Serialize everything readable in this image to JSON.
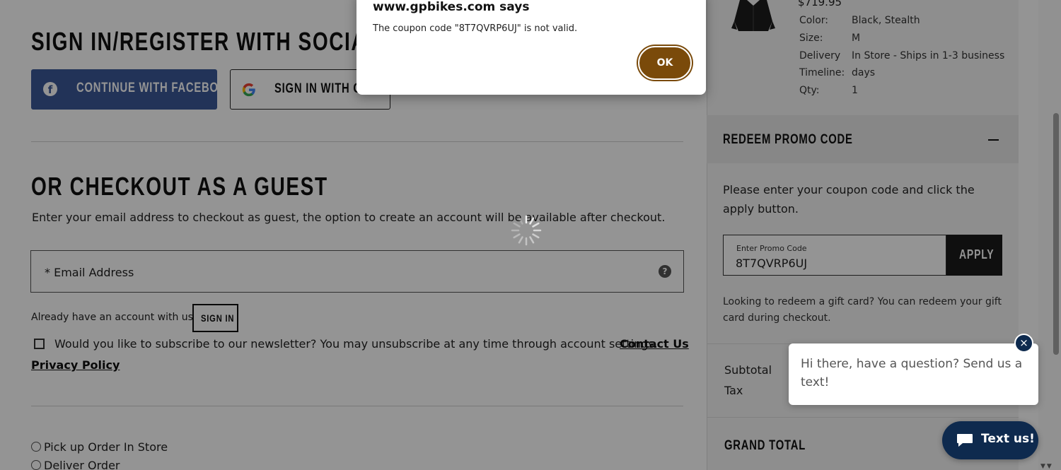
{
  "social": {
    "heading": "SIGN IN/REGISTER WITH SOCIAL",
    "facebook_label": "CONTINUE WITH FACEBOOK",
    "google_label": "SIGN IN WITH GOOGLE"
  },
  "guest": {
    "heading": "OR CHECKOUT AS A GUEST",
    "description": "Enter your email address to checkout as guest, the option to create an account will be available after checkout.",
    "email_placeholder": "* Email Address",
    "help_glyph": "?",
    "already_text": "Already have an account with us?",
    "signin_label": "SIGN IN",
    "newsletter_text": "Would you like to subscribe to our newsletter? You may unsubscribe at any time through account settings.",
    "contact_link": "Contact Us",
    "privacy_link": "Privacy Policy",
    "delivery_options": [
      "Pick up Order In Store",
      "Deliver Order"
    ]
  },
  "cart": {
    "price": "$719.95",
    "details": [
      {
        "label": "Color:",
        "value": "Black, Stealth"
      },
      {
        "label": "Size:",
        "value": "M"
      },
      {
        "label": "Delivery",
        "value": "In Store - Ships in 1-3 business"
      },
      {
        "label": "Timeline:",
        "value": "days"
      },
      {
        "label": "Qty:",
        "value": "1"
      }
    ]
  },
  "promo": {
    "heading": "REDEEM PROMO CODE",
    "description": "Please enter your coupon code and click the apply button.",
    "field_label": "Enter Promo Code",
    "field_value": "8T7QVRP6UJ",
    "apply_label": "APPLY",
    "gift_text": "Looking to redeem a gift card? You can redeem your gift card during checkout."
  },
  "summary": {
    "subtotal_label": "Subtotal",
    "tax_label": "Tax",
    "grand_total_label": "GRAND TOTAL"
  },
  "chat": {
    "message": "Hi there, have a question? Send us a text!",
    "close_glyph": "×",
    "button_label": "Text us!"
  },
  "dialog": {
    "title": "www.gpbikes.com says",
    "message": "The coupon code \"8T7QVRP6UJ\" is not valid.",
    "ok_label": "OK"
  },
  "colors": {
    "facebook": "#3b5998",
    "chat_navy": "#0e2a4e",
    "ok_brown": "#7a4a0a"
  }
}
